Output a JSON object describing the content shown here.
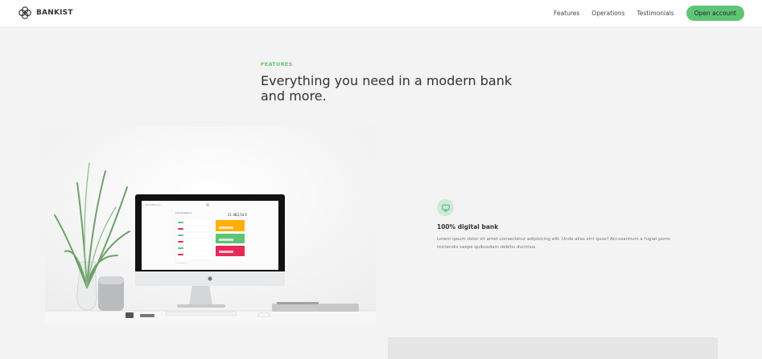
{
  "brand": {
    "name": "BANKIST",
    "accent": "#5ec576"
  },
  "nav": {
    "links": [
      "Features",
      "Operations",
      "Testimonials"
    ],
    "cta": "Open account"
  },
  "section": {
    "label": "FEATURES",
    "title": "Everything you need in a modern bank and more."
  },
  "feature": {
    "icon": "monitor-icon",
    "title": "100% digital bank",
    "text": "Lorem ipsum dolor sit amet consectetur adipisicing elit. Unde alias sint quos? Accusantium a fugiat porro reiciendis saepe quibusdam debitis ducimus."
  },
  "screen": {
    "balance": "21 482,54 €"
  }
}
